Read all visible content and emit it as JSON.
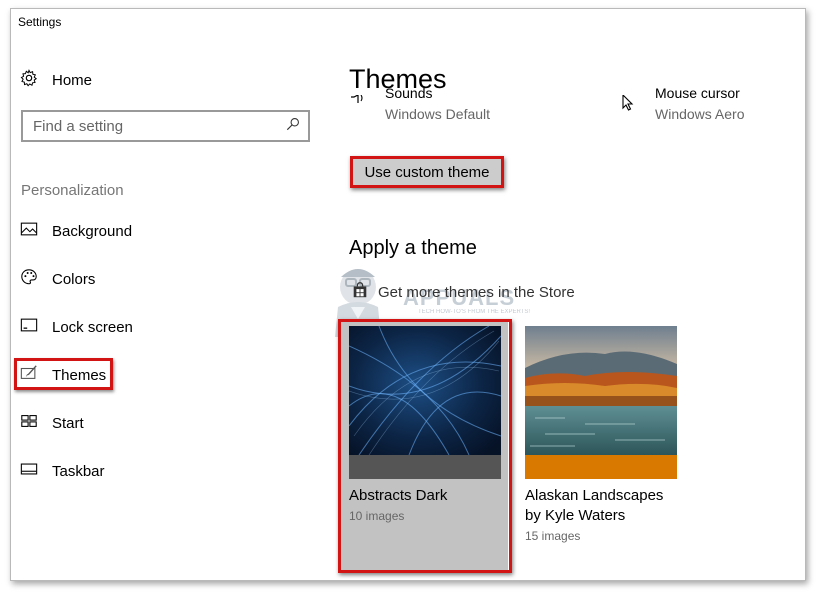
{
  "window": {
    "title": "Settings"
  },
  "sidebar": {
    "home_label": "Home",
    "search_placeholder": "Find a setting",
    "section_title": "Personalization",
    "items": [
      {
        "label": "Background",
        "icon": "picture-icon"
      },
      {
        "label": "Colors",
        "icon": "palette-icon"
      },
      {
        "label": "Lock screen",
        "icon": "lock-screen-icon"
      },
      {
        "label": "Themes",
        "icon": "brush-icon",
        "selected": true
      },
      {
        "label": "Start",
        "icon": "start-grid-icon"
      },
      {
        "label": "Taskbar",
        "icon": "taskbar-icon"
      }
    ]
  },
  "main": {
    "title": "Themes",
    "sounds": {
      "label": "Sounds",
      "value": "Windows Default",
      "icon": "speaker-icon"
    },
    "mouse_cursor": {
      "label": "Mouse cursor",
      "value": "Windows Aero",
      "icon": "cursor-icon"
    },
    "use_custom_button": "Use custom theme",
    "apply_title": "Apply a theme",
    "store_link": "Get more themes in the Store",
    "themes": [
      {
        "name": "Abstracts Dark",
        "count": "10 images",
        "accent": "#555555",
        "selected": true
      },
      {
        "name": "Alaskan Landscapes by Kyle Waters",
        "count": "15 images",
        "accent": "#d97900",
        "selected": false
      }
    ]
  },
  "watermark": {
    "text": "APPUALS",
    "sub": "TECH HOW-TO'S FROM THE EXPERTS!"
  },
  "colors": {
    "highlight": "#d21414",
    "selected_card": "#c2c2c2",
    "button": "#cccccc"
  }
}
